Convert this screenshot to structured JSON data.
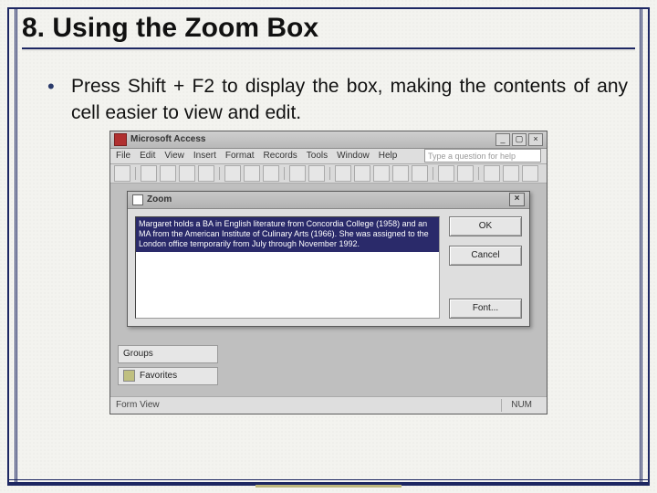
{
  "slide": {
    "title": "8. Using the Zoom Box",
    "bullet": "Press Shift + F2 to display the box, making the contents of any cell easier to view and edit."
  },
  "access": {
    "app_title": "Microsoft Access",
    "menus": [
      "File",
      "Edit",
      "View",
      "Insert",
      "Format",
      "Records",
      "Tools",
      "Window",
      "Help"
    ],
    "help_placeholder": "Type a question for help",
    "zoom": {
      "title": "Zoom",
      "text": "Margaret holds a BA in English literature from Concordia College (1958) and an MA from the American Institute of Culinary Arts (1966). She was assigned to the London office temporarily from July through November 1992.",
      "buttons": {
        "ok": "OK",
        "cancel": "Cancel",
        "font": "Font..."
      }
    },
    "side_tabs": {
      "groups": "Groups",
      "favorites": "Favorites"
    },
    "status": {
      "view": "Form View",
      "num": "NUM"
    }
  }
}
